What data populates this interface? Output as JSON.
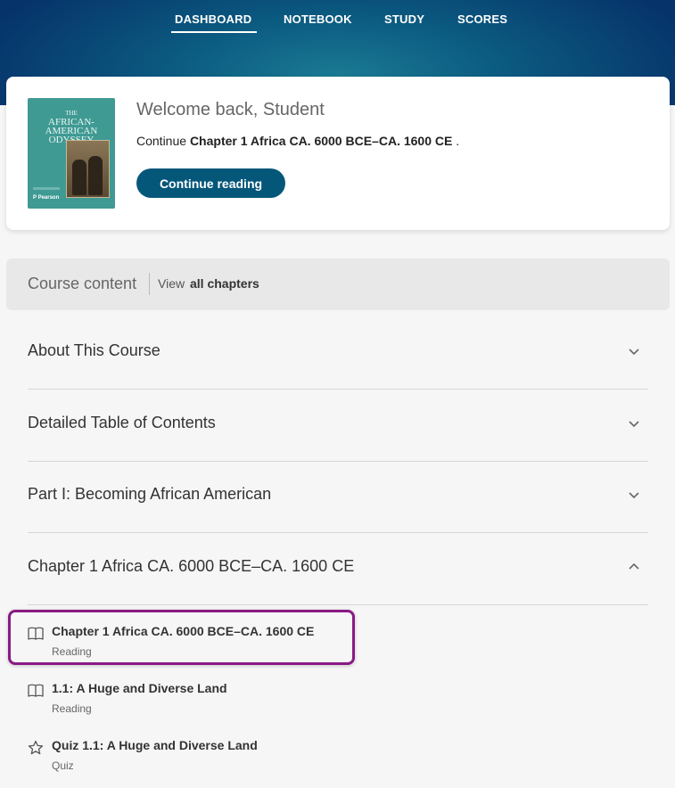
{
  "nav": {
    "items": [
      {
        "label": "DASHBOARD",
        "active": true
      },
      {
        "label": "NOTEBOOK"
      },
      {
        "label": "STUDY"
      },
      {
        "label": "SCORES"
      }
    ]
  },
  "welcome": {
    "title": "Welcome back, Student",
    "continue_prefix": "Continue",
    "continue_chapter": "Chapter 1 Africa CA. 6000 BCE–CA. 1600 CE",
    "continue_suffix": ".",
    "button_label": "Continue reading",
    "cover": {
      "title_lines": [
        "THE",
        "AFRICAN-",
        "AMERICAN",
        "ODYSSEY"
      ],
      "publisher": "Pearson"
    }
  },
  "course": {
    "title": "Course content",
    "view_label": "View",
    "view_link": "all chapters"
  },
  "accordion": [
    {
      "label": "About This Course",
      "expanded": false
    },
    {
      "label": "Detailed Table of Contents",
      "expanded": false
    },
    {
      "label": "Part I: Becoming African American",
      "expanded": false
    },
    {
      "label": "Chapter 1 Africa CA. 6000 BCE–CA. 1600 CE",
      "expanded": true
    }
  ],
  "chapter_items": [
    {
      "title": "Chapter 1 Africa CA. 6000 BCE–CA. 1600 CE",
      "type": "Reading",
      "icon": "book-icon",
      "highlighted": true
    },
    {
      "title": "1.1: A Huge and Diverse Land",
      "type": "Reading",
      "icon": "book-icon"
    },
    {
      "title": "Quiz 1.1: A Huge and Diverse Land",
      "type": "Quiz",
      "icon": "star-icon"
    }
  ],
  "colors": {
    "header_dark": "#06336a",
    "header_teal": "#1a7a93",
    "button": "#05577a",
    "highlight": "#8a1a84",
    "cover": "#3f9a93"
  }
}
